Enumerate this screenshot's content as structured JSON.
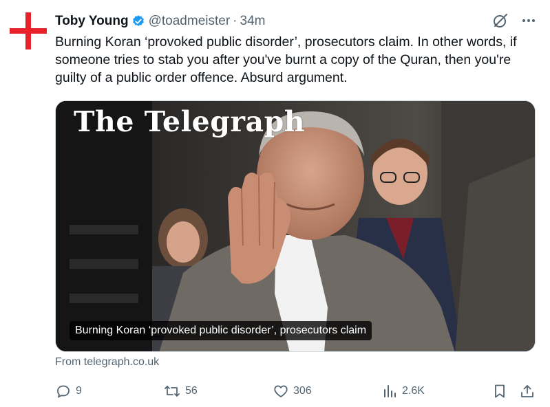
{
  "tweet": {
    "display_name": "Toby Young",
    "handle": "@toadmeister",
    "separator": "·",
    "timestamp": "34m",
    "text": "Burning Koran ‘provoked public disorder’, prosecutors claim. In other words, if someone tries to stab you after you've burnt a copy of the Quran, then you're guilty of a public order offence. Absurd argument.",
    "verified_color": "#1d9bf0"
  },
  "card": {
    "masthead": "The Telegraph",
    "caption": "Burning Koran ‘provoked public disorder’, prosecutors claim",
    "source": "From telegraph.co.uk"
  },
  "actions": {
    "replies": "9",
    "reposts": "56",
    "likes": "306",
    "views": "2.6K"
  },
  "icons": [
    "red-cross-avatar",
    "verified-badge-icon",
    "grok-icon",
    "more-icon",
    "reply-icon",
    "repost-icon",
    "like-icon",
    "views-icon",
    "bookmark-icon",
    "share-icon"
  ]
}
